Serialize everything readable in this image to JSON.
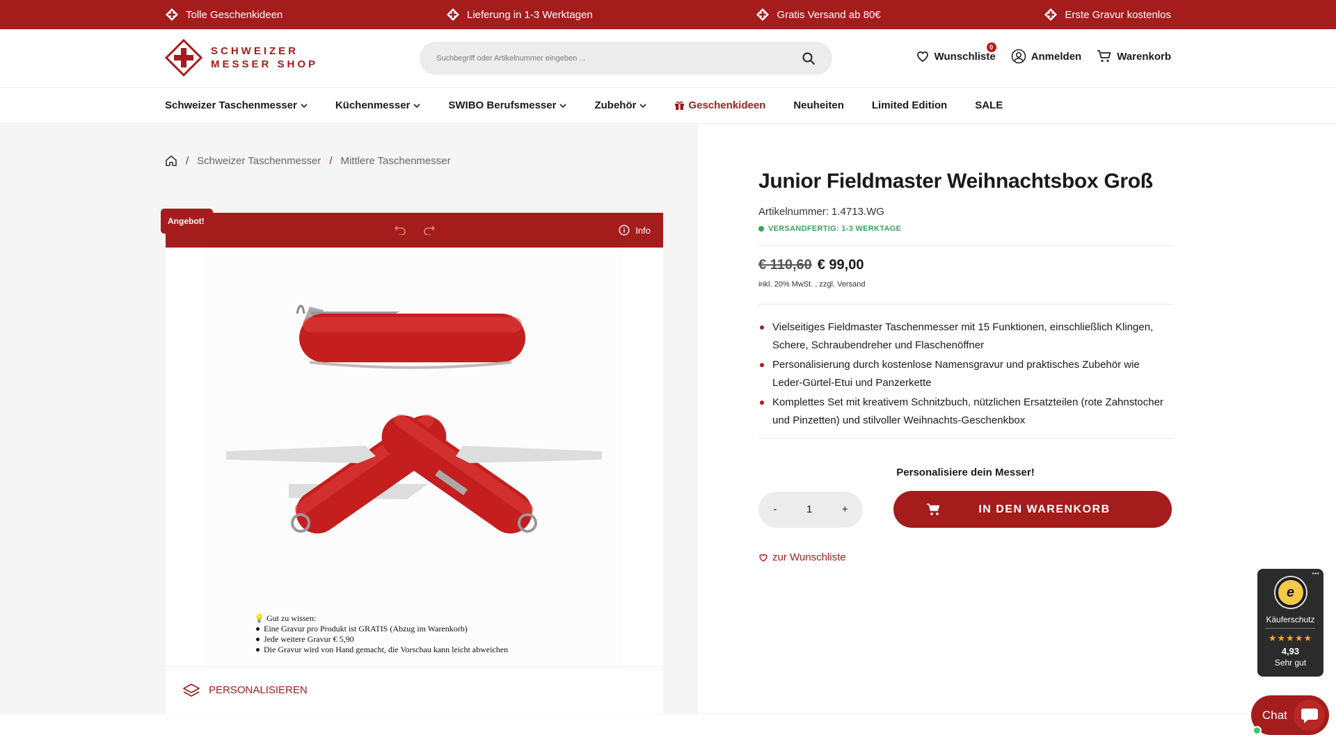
{
  "topbar": {
    "usps": [
      "Tolle Geschenkideen",
      "Lieferung in 1-3 Werktagen",
      "Gratis Versand ab 80€",
      "Erste Gravur kostenlos"
    ]
  },
  "header": {
    "logo_line1": "SCHWEIZER",
    "logo_line2": "MESSER SHOP",
    "search_placeholder": "Suchbegriff oder Artikelnummer eingeben ...",
    "wishlist_label": "Wunschliste",
    "wishlist_count": "0",
    "login_label": "Anmelden",
    "cart_label": "Warenkorb"
  },
  "nav": {
    "items": [
      {
        "label": "Schweizer Taschenmesser"
      },
      {
        "label": "Küchenmesser"
      },
      {
        "label": "SWIBO Berufsmesser"
      },
      {
        "label": "Zubehör"
      },
      {
        "label": "Geschenkideen"
      },
      {
        "label": "Neuheiten"
      },
      {
        "label": "Limited Edition"
      },
      {
        "label": "SALE"
      }
    ]
  },
  "breadcrumb": {
    "items": [
      "Schweizer Taschenmesser",
      "Mittlere Taschenmesser"
    ]
  },
  "configurator": {
    "offer_badge": "Angebot!",
    "info_label": "Info",
    "note_title": "Gut zu wissen:",
    "note_items": [
      "Eine Gravur pro Produkt ist GRATIS (Abzug im Warenkorb)",
      "Jede weitere Gravur € 5,90",
      "Die Gravur wird von Hand gemacht, die Vorschau kann leicht abweichen"
    ],
    "personalize_label": "PERSONALISIEREN"
  },
  "product": {
    "title": "Junior Fieldmaster Weihnachtsbox Groß",
    "article_number": "Artikelnummer: 1.4713.WG",
    "stock_status": "VERSANDFERTIG: 1-3 WERKTAGE",
    "old_price": "€ 110,60",
    "price": "€ 99,00",
    "tax_note": "inkl. 20% MwSt. , zzgl. Versand",
    "bullets": [
      "Vielseitiges Fieldmaster Taschenmesser mit 15 Funktionen, einschließlich Klingen, Schere, Schraubendreher und Flaschenöffner",
      "Personalisierung durch kostenlose Namensgravur und praktisches Zubehör wie Leder-Gürtel-Etui und Panzerkette",
      "Komplettes Set mit kreativem Schnitzbuch, nützlichen Ersatzteilen (rote Zahnstocher und Pinzetten) und stilvoller Weihnachts-Geschenkbox"
    ],
    "personalize_prompt": "Personalisiere dein Messer!",
    "qty_minus": "-",
    "qty_value": "1",
    "qty_plus": "+",
    "add_to_cart": "IN DEN WARENKORB",
    "wishlist_link": "zur Wunschliste"
  },
  "trust_badge": {
    "label": "Käuferschutz",
    "stars": "★★★★★",
    "score": "4,93",
    "rating_word": "Sehr gut",
    "seal_letter": "e"
  },
  "chat": {
    "label": "Chat"
  },
  "colors": {
    "brand_red": "#a51c1c",
    "stock_green": "#3aa35a",
    "background_grey": "#f5f5f5"
  }
}
